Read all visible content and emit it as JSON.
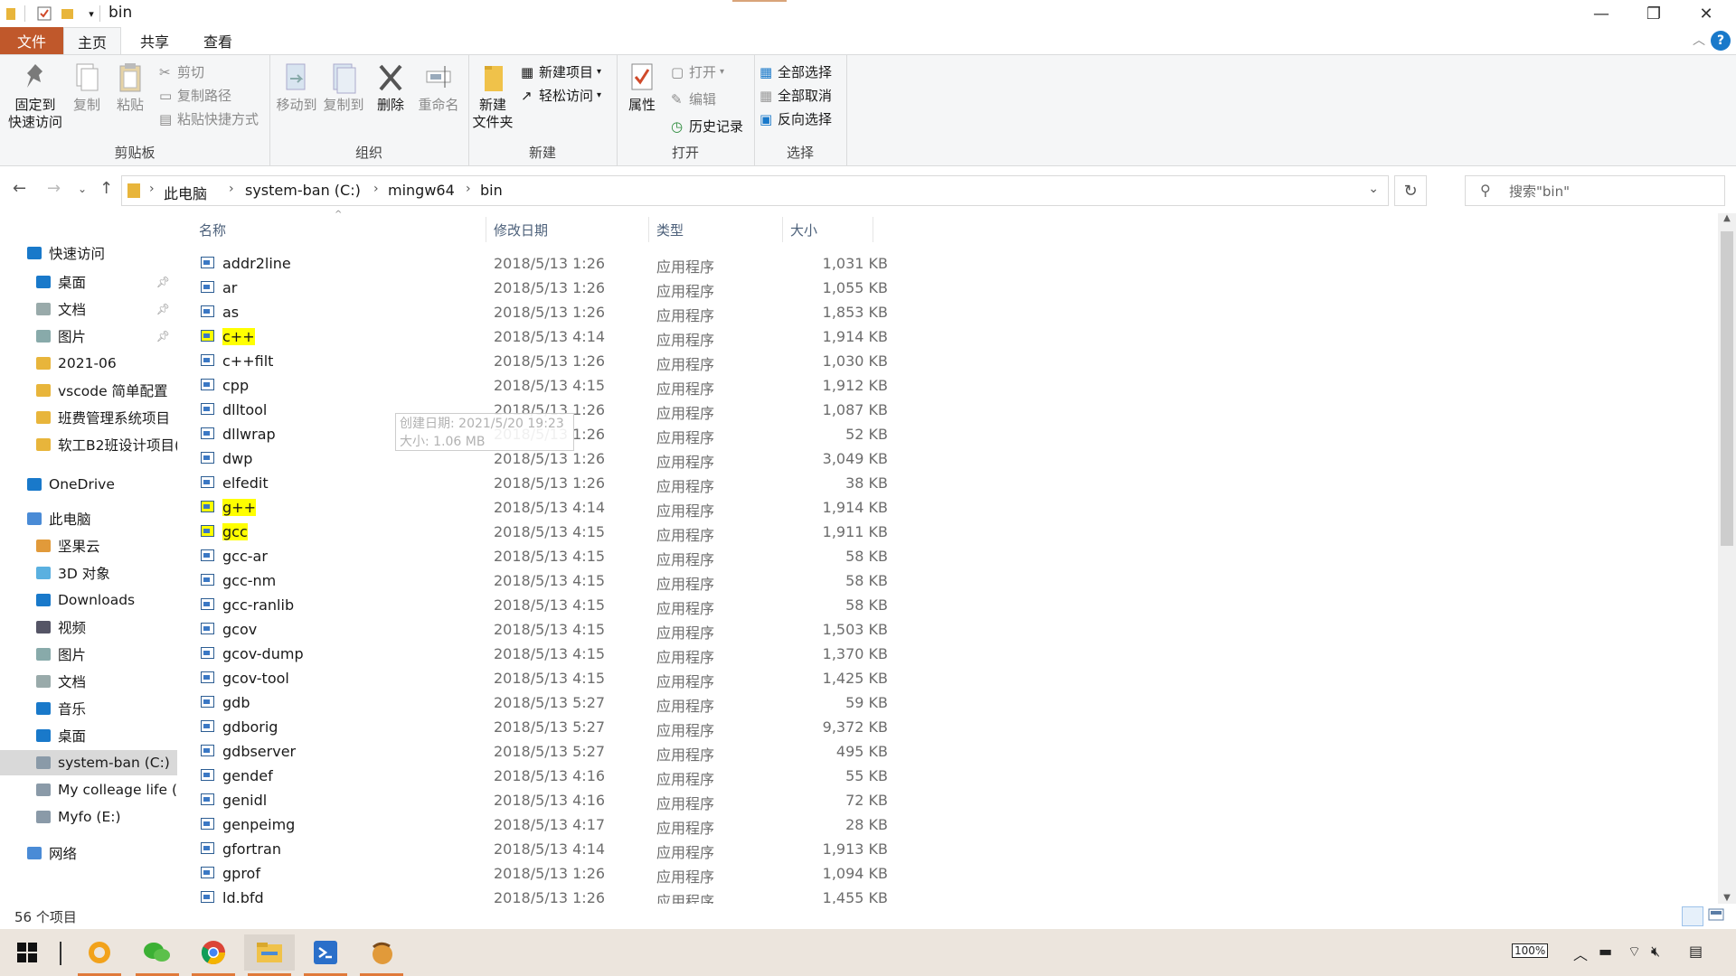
{
  "window": {
    "title": "bin",
    "minimize": "—",
    "maximize": "❐",
    "close": "✕"
  },
  "tabs": {
    "file": "文件",
    "home": "主页",
    "share": "共享",
    "view": "查看",
    "help": "?"
  },
  "ribbon": {
    "clipboard": {
      "label": "剪贴板",
      "pin": "固定到\n快速访问",
      "copy": "复制",
      "paste": "粘贴",
      "cut": "剪切",
      "copy_path": "复制路径",
      "paste_shortcut": "粘贴快捷方式"
    },
    "organize": {
      "label": "组织",
      "move_to": "移动到",
      "copy_to": "复制到",
      "delete": "删除",
      "rename": "重命名"
    },
    "new": {
      "label": "新建",
      "new_folder": "新建\n文件夹",
      "new_item": "新建项目",
      "easy_access": "轻松访问"
    },
    "open": {
      "label": "打开",
      "properties": "属性",
      "open": "打开",
      "edit": "编辑",
      "history": "历史记录"
    },
    "select": {
      "label": "选择",
      "select_all": "全部选择",
      "select_none": "全部取消",
      "invert": "反向选择"
    }
  },
  "address": {
    "crumbs": [
      "此电脑",
      "system-ban (C:)",
      "mingw64",
      "bin"
    ],
    "search_placeholder": "搜索\"bin\""
  },
  "nav": {
    "items": [
      {
        "label": "快速访问",
        "icon": "star-icon",
        "level": 0
      },
      {
        "label": "桌面",
        "icon": "desktop-icon",
        "level": 1,
        "pinned": true
      },
      {
        "label": "文档",
        "icon": "document-icon",
        "level": 1,
        "pinned": true
      },
      {
        "label": "图片",
        "icon": "picture-icon",
        "level": 1,
        "pinned": true
      },
      {
        "label": "2021-06",
        "icon": "folder-icon",
        "level": 1
      },
      {
        "label": "vscode 简单配置",
        "icon": "folder-icon",
        "level": 1
      },
      {
        "label": "班费管理系统项目",
        "icon": "folder-icon",
        "level": 1
      },
      {
        "label": "软工B2班设计项目(",
        "icon": "folder-icon",
        "level": 1
      },
      {
        "label": "OneDrive",
        "icon": "cloud-icon",
        "level": 0
      },
      {
        "label": "此电脑",
        "icon": "computer-icon",
        "level": 0
      },
      {
        "label": "坚果云",
        "icon": "nut-icon",
        "level": 1
      },
      {
        "label": "3D 对象",
        "icon": "cube-icon",
        "level": 1
      },
      {
        "label": "Downloads",
        "icon": "download-icon",
        "level": 1
      },
      {
        "label": "视频",
        "icon": "video-icon",
        "level": 1
      },
      {
        "label": "图片",
        "icon": "picture-icon",
        "level": 1
      },
      {
        "label": "文档",
        "icon": "document-icon",
        "level": 1
      },
      {
        "label": "音乐",
        "icon": "music-icon",
        "level": 1
      },
      {
        "label": "桌面",
        "icon": "desktop-icon",
        "level": 1
      },
      {
        "label": "system-ban (C:)",
        "icon": "drive-icon",
        "level": 1,
        "selected": true
      },
      {
        "label": "My colleage life (D",
        "icon": "drive-icon",
        "level": 1
      },
      {
        "label": "Myfo (E:)",
        "icon": "drive-icon",
        "level": 1
      },
      {
        "label": "网络",
        "icon": "network-icon",
        "level": 0
      }
    ]
  },
  "columns": {
    "name": "名称",
    "date": "修改日期",
    "type": "类型",
    "size": "大小"
  },
  "files": [
    {
      "name": "addr2line",
      "date": "2018/5/13 1:26",
      "type": "应用程序",
      "size": "1,031 KB"
    },
    {
      "name": "ar",
      "date": "2018/5/13 1:26",
      "type": "应用程序",
      "size": "1,055 KB"
    },
    {
      "name": "as",
      "date": "2018/5/13 1:26",
      "type": "应用程序",
      "size": "1,853 KB"
    },
    {
      "name": "c++",
      "date": "2018/5/13 4:14",
      "type": "应用程序",
      "size": "1,914 KB",
      "highlight": true
    },
    {
      "name": "c++filt",
      "date": "2018/5/13 1:26",
      "type": "应用程序",
      "size": "1,030 KB"
    },
    {
      "name": "cpp",
      "date": "2018/5/13 4:15",
      "type": "应用程序",
      "size": "1,912 KB"
    },
    {
      "name": "dlltool",
      "date": "2018/5/13 1:26",
      "type": "应用程序",
      "size": "1,087 KB"
    },
    {
      "name": "dllwrap",
      "date": "2018/5/13 1:26",
      "type": "应用程序",
      "size": "52 KB"
    },
    {
      "name": "dwp",
      "date": "2018/5/13 1:26",
      "type": "应用程序",
      "size": "3,049 KB"
    },
    {
      "name": "elfedit",
      "date": "2018/5/13 1:26",
      "type": "应用程序",
      "size": "38 KB"
    },
    {
      "name": "g++",
      "date": "2018/5/13 4:14",
      "type": "应用程序",
      "size": "1,914 KB",
      "highlight": true
    },
    {
      "name": "gcc",
      "date": "2018/5/13 4:15",
      "type": "应用程序",
      "size": "1,911 KB",
      "highlight": true
    },
    {
      "name": "gcc-ar",
      "date": "2018/5/13 4:15",
      "type": "应用程序",
      "size": "58 KB"
    },
    {
      "name": "gcc-nm",
      "date": "2018/5/13 4:15",
      "type": "应用程序",
      "size": "58 KB"
    },
    {
      "name": "gcc-ranlib",
      "date": "2018/5/13 4:15",
      "type": "应用程序",
      "size": "58 KB"
    },
    {
      "name": "gcov",
      "date": "2018/5/13 4:15",
      "type": "应用程序",
      "size": "1,503 KB"
    },
    {
      "name": "gcov-dump",
      "date": "2018/5/13 4:15",
      "type": "应用程序",
      "size": "1,370 KB"
    },
    {
      "name": "gcov-tool",
      "date": "2018/5/13 4:15",
      "type": "应用程序",
      "size": "1,425 KB"
    },
    {
      "name": "gdb",
      "date": "2018/5/13 5:27",
      "type": "应用程序",
      "size": "59 KB"
    },
    {
      "name": "gdborig",
      "date": "2018/5/13 5:27",
      "type": "应用程序",
      "size": "9,372 KB"
    },
    {
      "name": "gdbserver",
      "date": "2018/5/13 5:27",
      "type": "应用程序",
      "size": "495 KB"
    },
    {
      "name": "gendef",
      "date": "2018/5/13 4:16",
      "type": "应用程序",
      "size": "55 KB"
    },
    {
      "name": "genidl",
      "date": "2018/5/13 4:16",
      "type": "应用程序",
      "size": "72 KB"
    },
    {
      "name": "genpeimg",
      "date": "2018/5/13 4:17",
      "type": "应用程序",
      "size": "28 KB"
    },
    {
      "name": "gfortran",
      "date": "2018/5/13 4:14",
      "type": "应用程序",
      "size": "1,913 KB"
    },
    {
      "name": "gprof",
      "date": "2018/5/13 1:26",
      "type": "应用程序",
      "size": "1,094 KB"
    },
    {
      "name": "ld.bfd",
      "date": "2018/5/13 1:26",
      "type": "应用程序",
      "size": "1,455 KB"
    }
  ],
  "tooltip": {
    "line1": "创建日期: 2021/5/20 19:23",
    "line2": "大小: 1.06 MB"
  },
  "status": {
    "count": "56 个项目"
  },
  "taskbar": {
    "battery": "100%",
    "apps": [
      "windows-start-icon",
      "browser-icon",
      "wechat-icon",
      "chrome-icon",
      "file-explorer-icon",
      "vscode-icon",
      "nutstore-icon"
    ]
  },
  "colors": {
    "file_tab": "#c0582b",
    "highlight": "#ffff00",
    "accent": "#1979ca"
  }
}
